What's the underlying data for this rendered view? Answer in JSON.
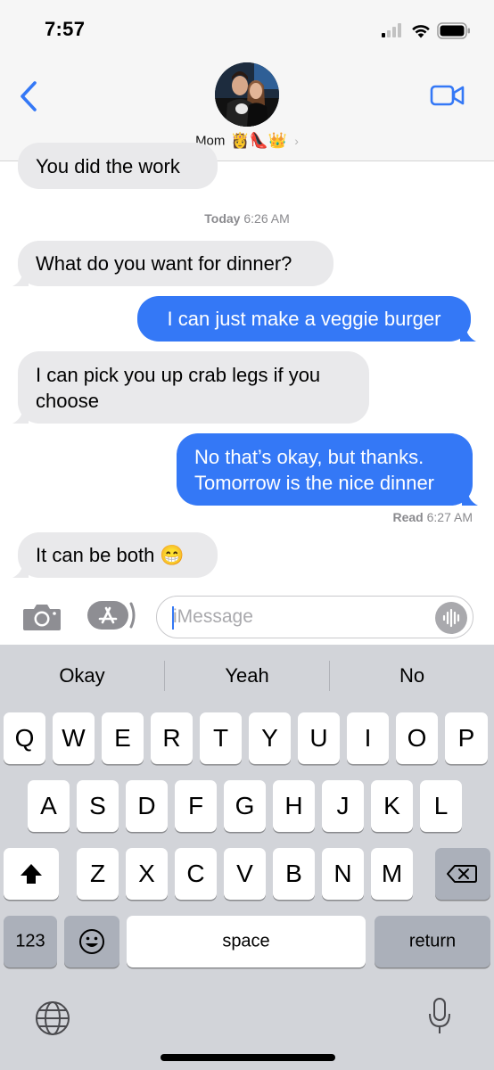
{
  "status_bar": {
    "time": "7:57"
  },
  "header": {
    "contact_name": "Mom",
    "contact_emoji": "👸👠👑",
    "chevron": "›"
  },
  "conversation": {
    "messages": [
      {
        "direction": "received",
        "text": "You did the work"
      },
      {
        "type": "timestamp",
        "day": "Today",
        "time": "6:26 AM"
      },
      {
        "direction": "received",
        "text": "What do you want for dinner?"
      },
      {
        "direction": "sent",
        "text": "I can just make a veggie burger"
      },
      {
        "direction": "received",
        "text": "I can pick you up crab legs if you choose"
      },
      {
        "direction": "sent",
        "text": "No that’s okay, but thanks. Tomorrow is the nice dinner"
      },
      {
        "type": "read_receipt",
        "label": "Read",
        "time": "6:27 AM"
      },
      {
        "direction": "received",
        "text": "It can be both 😁"
      }
    ]
  },
  "input": {
    "placeholder": "iMessage"
  },
  "keyboard": {
    "suggestions": [
      "Okay",
      "Yeah",
      "No"
    ],
    "row1": [
      "Q",
      "W",
      "E",
      "R",
      "T",
      "Y",
      "U",
      "I",
      "O",
      "P"
    ],
    "row2": [
      "A",
      "S",
      "D",
      "F",
      "G",
      "H",
      "J",
      "K",
      "L"
    ],
    "row3": [
      "Z",
      "X",
      "C",
      "V",
      "B",
      "N",
      "M"
    ],
    "numbers_key": "123",
    "space_key": "space",
    "return_key": "return"
  },
  "icons": {
    "back": "chevron-left-icon",
    "video": "video-camera-icon",
    "camera": "camera-icon",
    "apps": "app-store-icon",
    "voice": "waveform-icon",
    "shift": "shift-arrow-icon",
    "delete": "backspace-icon",
    "emoji": "emoji-face-icon",
    "globe": "globe-icon",
    "dictation": "microphone-icon"
  },
  "colors": {
    "sent_bubble": "#3478f6",
    "received_bubble": "#e9e9eb",
    "accent": "#3478f6",
    "keyboard_bg": "#d2d4d9"
  }
}
